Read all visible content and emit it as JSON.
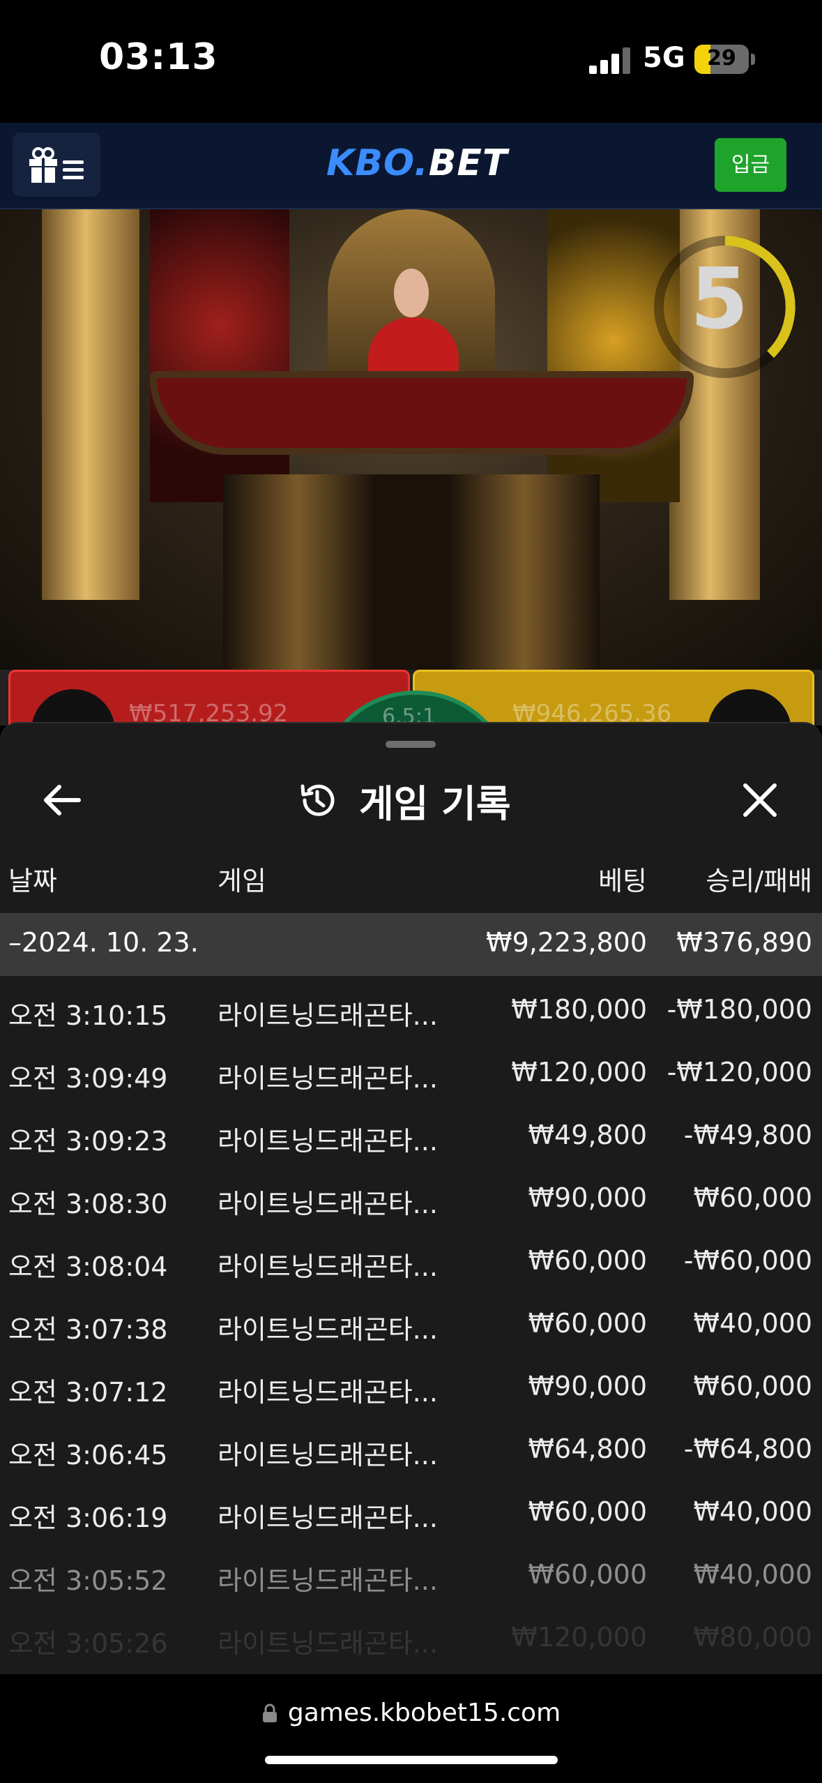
{
  "status_bar": {
    "time": "03:13",
    "network": "5G",
    "battery": "29",
    "battery_level": 0.29
  },
  "header": {
    "logo_part1": "KBO.",
    "logo_part2": "BET",
    "deposit_label": "입금"
  },
  "video": {
    "countdown": "5"
  },
  "bets": {
    "left_amount": "₩517,253.92",
    "right_amount": "₩946,265.36",
    "odds": "6.5:1"
  },
  "sheet": {
    "title": "게임 기록",
    "columns": {
      "date": "날짜",
      "game": "게임",
      "bet": "베팅",
      "winloss": "승리/패배"
    },
    "summary": {
      "date": "–2024. 10. 23.",
      "bet": "₩9,223,800",
      "winloss": "₩376,890"
    },
    "rows": [
      {
        "time": "오전 3:10:15",
        "game": "라이트닝드래곤타...",
        "bet": "₩180,000",
        "winloss": "-₩180,000"
      },
      {
        "time": "오전 3:09:49",
        "game": "라이트닝드래곤타...",
        "bet": "₩120,000",
        "winloss": "-₩120,000"
      },
      {
        "time": "오전 3:09:23",
        "game": "라이트닝드래곤타...",
        "bet": "₩49,800",
        "winloss": "-₩49,800"
      },
      {
        "time": "오전 3:08:30",
        "game": "라이트닝드래곤타...",
        "bet": "₩90,000",
        "winloss": "₩60,000"
      },
      {
        "time": "오전 3:08:04",
        "game": "라이트닝드래곤타...",
        "bet": "₩60,000",
        "winloss": "-₩60,000"
      },
      {
        "time": "오전 3:07:38",
        "game": "라이트닝드래곤타...",
        "bet": "₩60,000",
        "winloss": "₩40,000"
      },
      {
        "time": "오전 3:07:12",
        "game": "라이트닝드래곤타...",
        "bet": "₩90,000",
        "winloss": "₩60,000"
      },
      {
        "time": "오전 3:06:45",
        "game": "라이트닝드래곤타...",
        "bet": "₩64,800",
        "winloss": "-₩64,800"
      },
      {
        "time": "오전 3:06:19",
        "game": "라이트닝드래곤타...",
        "bet": "₩60,000",
        "winloss": "₩40,000"
      },
      {
        "time": "오전 3:05:52",
        "game": "라이트닝드래곤타...",
        "bet": "₩60,000",
        "winloss": "₩40,000"
      },
      {
        "time": "오전 3:05:26",
        "game": "라이트닝드래곤타...",
        "bet": "₩120,000",
        "winloss": "₩80,000"
      }
    ]
  },
  "browser": {
    "url": "games.kbobet15.com"
  },
  "colors": {
    "header_bg": "#0b1730",
    "logo_blue": "#3b8cff",
    "deposit_green": "#1fa42b",
    "sheet_bg": "#1b1b1b",
    "summary_bg": "#3a3a3a"
  },
  "icons": {
    "menu": "gift-menu-icon",
    "back": "arrow-left-icon",
    "history": "history-icon",
    "close": "close-icon",
    "lock": "lock-icon"
  }
}
